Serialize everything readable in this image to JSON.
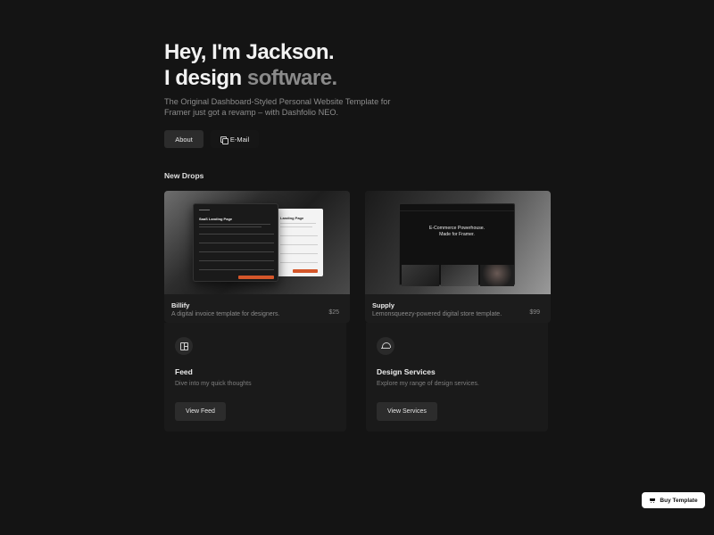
{
  "hero": {
    "line1": "Hey, I'm Jackson.",
    "line2_a": "I design ",
    "line2_b": "software.",
    "intro": "The Original Dashboard-Styled Personal Website Template for Framer just got a revamp – with Dashfolio NEO."
  },
  "actions": {
    "about_label": "About",
    "email_label": "E-Mail"
  },
  "new_drops": {
    "title": "New Drops",
    "items": [
      {
        "title": "Billify",
        "description": "A digital invoice template for designers.",
        "price": "$25",
        "preview_heading": "SaaS Landing Page",
        "preview_heading_light": "Landing Page"
      },
      {
        "title": "Supply",
        "description": "Lemonsqueezy-powered digital store template.",
        "price": "$99",
        "preview_heading": "E-Commerce Powerhouse.",
        "preview_subheading": "Made for Framer."
      }
    ]
  },
  "panels": [
    {
      "icon": "layout-icon",
      "title": "Feed",
      "description": "Dive into my quick thoughts",
      "button": "View Feed"
    },
    {
      "icon": "dome-icon",
      "title": "Design Services",
      "description": "Explore my range of design services.",
      "button": "View Services"
    }
  ],
  "buy_button": "Buy Template",
  "colors": {
    "background": "#141414",
    "card": "#1c1c1c",
    "accent_orange": "#d4562a"
  }
}
